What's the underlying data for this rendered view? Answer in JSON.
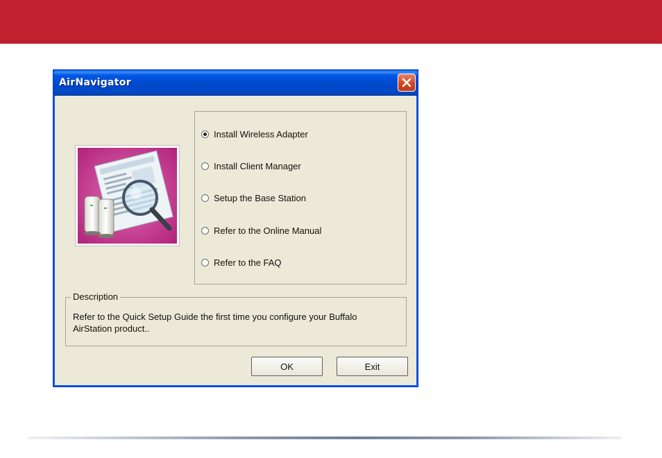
{
  "window": {
    "title": "AirNavigator",
    "close_icon": "close-icon"
  },
  "illustration": {
    "icon": "airstation-quick-setup-guide-illustration"
  },
  "options": [
    {
      "label": "Install Wireless Adapter",
      "selected": true
    },
    {
      "label": "Install Client Manager",
      "selected": false
    },
    {
      "label": "Setup the Base Station",
      "selected": false
    },
    {
      "label": "Refer to the Online Manual",
      "selected": false
    },
    {
      "label": "Refer to the FAQ",
      "selected": false
    }
  ],
  "description": {
    "legend": "Description",
    "text": "Refer to the Quick Setup Guide the first time you configure your Buffalo AirStation product.."
  },
  "buttons": {
    "ok": "OK",
    "exit": "Exit"
  },
  "colors": {
    "banner": "#c1202e",
    "titlebar": "#0047c9",
    "dialog_bg": "#ece9d8"
  }
}
